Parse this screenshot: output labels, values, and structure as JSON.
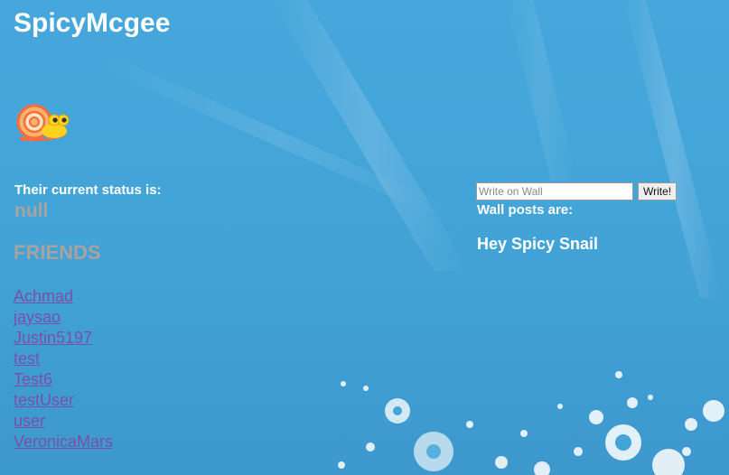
{
  "profile": {
    "username": "SpicyMcgee",
    "avatar_icon": "snail-icon",
    "status_label": "Their current status is:",
    "status_value": "null"
  },
  "friends": {
    "heading": "FRIENDS",
    "items": [
      {
        "name": "Achmad"
      },
      {
        "name": "jaysao"
      },
      {
        "name": "Justin5197"
      },
      {
        "name": "test"
      },
      {
        "name": "Test6"
      },
      {
        "name": "testUser"
      },
      {
        "name": "user"
      },
      {
        "name": "VeronicaMars"
      }
    ]
  },
  "wall": {
    "input_placeholder": "Write on Wall",
    "button_label": "Write!",
    "posts_label": "Wall posts are:",
    "posts": [
      {
        "text": "Hey Spicy Snail"
      }
    ]
  },
  "colors": {
    "background": "#46a7dc",
    "heading_text": "#ffffff",
    "muted_text": "#a8a3a0",
    "link": "#7b4fa8"
  }
}
